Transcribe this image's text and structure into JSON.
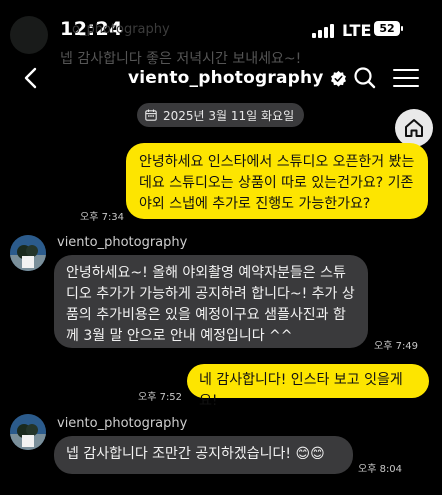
{
  "status_bar": {
    "time": "12:24",
    "network": "LTE",
    "battery": "52"
  },
  "notification": {
    "sender": "o_photography",
    "preview": "넵 감사합니다 좋은 저녁시간 보내세요~!"
  },
  "header": {
    "title": "viento_photography",
    "verified": true
  },
  "date_label": "2025년 3월 11일 화요일",
  "messages": [
    {
      "from": "me",
      "text": "안녕하세요 인스타에서 스튜디오 오픈한거 봤는데요 스튜디오는 상품이 따로 있는건가요? 기존 야외 스냅에 추가로 진행도 가능한가요?",
      "time": "오후 7:34"
    },
    {
      "from": "them",
      "sender": "viento_photography",
      "text": "안녕하세요~! 올해 야외촬영 예약자분들은 스튜디오 추가가 가능하게 공지하려 합니다~! 추가 상품의 추가비용은 있을 예정이구요 샘플사진과 함께 3월 말 안으로 안내 예정입니다 ^^",
      "time": "오후 7:49"
    },
    {
      "from": "me",
      "text": "네 감사합니다! 인스타 보고 잇을게요!",
      "time": "오후 7:52"
    },
    {
      "from": "them",
      "sender": "viento_photography",
      "text": "넵 감사합니다 조만간 공지하겠습니다! 😊😊",
      "time": "오후 8:04"
    }
  ],
  "colors": {
    "my_bubble": "#fde500",
    "their_bubble": "#3a3a3c",
    "background": "#000000"
  },
  "icons": [
    "back-arrow-icon",
    "verified-badge-icon",
    "search-icon",
    "menu-icon",
    "calendar-icon",
    "home-icon"
  ]
}
